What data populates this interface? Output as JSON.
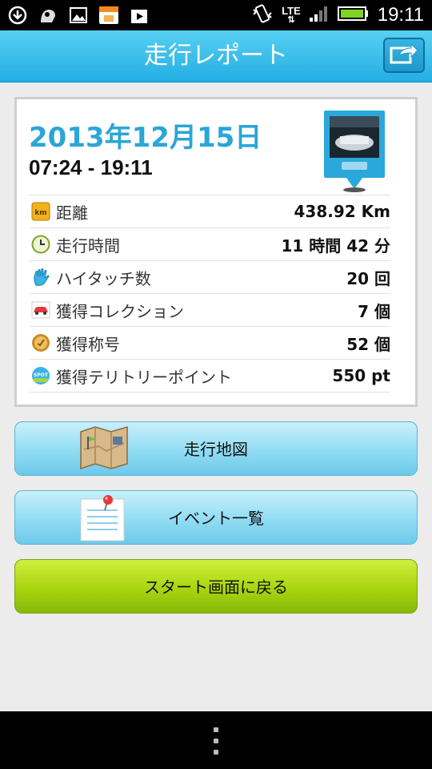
{
  "status_bar": {
    "network": "LTE",
    "time": "19:11",
    "icons": [
      "download-icon",
      "character-icon",
      "gallery-icon",
      "shop-icon",
      "play-store-icon",
      "vibrate-icon",
      "signal-icon",
      "battery-icon"
    ]
  },
  "header": {
    "title": "走行レポート",
    "share_icon": "share-icon"
  },
  "report": {
    "date": "2013年12月15日",
    "time_range": "07:24 - 19:11",
    "rows": [
      {
        "icon": "km-icon",
        "label": "距離",
        "value": "438.92 Km"
      },
      {
        "icon": "clock-icon",
        "label": "走行時間",
        "value": "11 時間 42 分"
      },
      {
        "icon": "hand-icon",
        "label": "ハイタッチ数",
        "value": "20 回"
      },
      {
        "icon": "car-icon",
        "label": "獲得コレクション",
        "value": "7 個"
      },
      {
        "icon": "medal-icon",
        "label": "獲得称号",
        "value": "52 個"
      },
      {
        "icon": "spot-icon",
        "label": "獲得テリトリーポイント",
        "value": "550 pt"
      }
    ]
  },
  "buttons": {
    "map": "走行地図",
    "events": "イベント一覧",
    "back_to_start": "スタート画面に戻る"
  },
  "colors": {
    "header": "#29b4e6",
    "date": "#2ba6d6",
    "blue_button": "#95def4",
    "green_button": "#a9d50f"
  }
}
